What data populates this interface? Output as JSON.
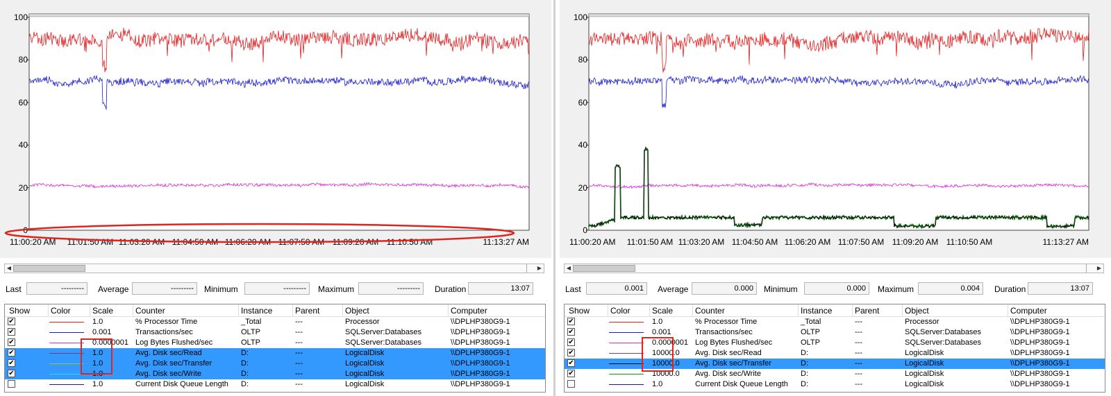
{
  "colors": {
    "red": "#e31c1c",
    "blue": "#1a1acc",
    "magenta": "#d92bd9",
    "green": "#119911",
    "black": "#000000",
    "highlight": "#3399ff",
    "annotation": "#e0231c"
  },
  "y_ticks": [
    "100",
    "80",
    "60",
    "40",
    "20",
    "0"
  ],
  "left": {
    "x_ticks": [
      "11:00:20 AM",
      "11:01:50 AM",
      "11:03:20 AM",
      "11:04:50 AM",
      "11:06:20 AM",
      "11:07:50 AM",
      "11:09:20 AM",
      "11:10:50 AM",
      "11:13:27 AM"
    ],
    "stats": {
      "last_label": "Last",
      "last": "---------",
      "average_label": "Average",
      "average": "---------",
      "minimum_label": "Minimum",
      "minimum": "---------",
      "maximum_label": "Maximum",
      "maximum": "---------",
      "duration_label": "Duration",
      "duration": "13:07"
    },
    "headers": [
      "Show",
      "Color",
      "Scale",
      "Counter",
      "Instance",
      "Parent",
      "Object",
      "Computer"
    ],
    "rows": [
      {
        "scale": "1.0",
        "counter": "% Processor Time",
        "instance": "_Total",
        "parent": "---",
        "object": "Processor",
        "computer": "\\\\DPLHP380G9-1",
        "color": "#e31c1c",
        "checked": true,
        "selected": false
      },
      {
        "scale": "0.001",
        "counter": "Transactions/sec",
        "instance": "OLTP",
        "parent": "---",
        "object": "SQLServer:Databases",
        "computer": "\\\\DPLHP380G9-1",
        "color": "#1a1acc",
        "checked": true,
        "selected": false
      },
      {
        "scale": "0.0000001",
        "counter": "Log Bytes Flushed/sec",
        "instance": "OLTP",
        "parent": "---",
        "object": "SQLServer:Databases",
        "computer": "\\\\DPLHP380G9-1",
        "color": "#d92bd9",
        "checked": true,
        "selected": false
      },
      {
        "scale": "1.0",
        "counter": "Avg. Disk sec/Read",
        "instance": "D:",
        "parent": "---",
        "object": "LogicalDisk",
        "computer": "\\\\DPLHP380G9-1",
        "color": "#7a3a7a",
        "checked": true,
        "selected": true
      },
      {
        "scale": "1.0",
        "counter": "Avg. Disk sec/Transfer",
        "instance": "D:",
        "parent": "---",
        "object": "LogicalDisk",
        "computer": "\\\\DPLHP380G9-1",
        "color": "#a0c040",
        "checked": true,
        "selected": true
      },
      {
        "scale": "1.0",
        "counter": "Avg. Disk sec/Write",
        "instance": "D:",
        "parent": "---",
        "object": "LogicalDisk",
        "computer": "\\\\DPLHP380G9-1",
        "color": "#20e0e0",
        "checked": true,
        "selected": true
      },
      {
        "scale": "1.0",
        "counter": "Current Disk Queue Length",
        "instance": "D:",
        "parent": "---",
        "object": "LogicalDisk",
        "computer": "\\\\DPLHP380G9-1",
        "color": "#1a1a80",
        "checked": false,
        "selected": false
      }
    ]
  },
  "right": {
    "x_ticks": [
      "11:00:20 AM",
      "11:01:50 AM",
      "11:03:20 AM",
      "11:04:50 AM",
      "11:06:20 AM",
      "11:07:50 AM",
      "11:09:20 AM",
      "11:10:50 AM",
      "11:13:27 AM"
    ],
    "stats": {
      "last_label": "Last",
      "last": "0.001",
      "average_label": "Average",
      "average": "0.000",
      "minimum_label": "Minimum",
      "minimum": "0.000",
      "maximum_label": "Maximum",
      "maximum": "0.004",
      "duration_label": "Duration",
      "duration": "13:07"
    },
    "headers": [
      "Show",
      "Color",
      "Scale",
      "Counter",
      "Instance",
      "Parent",
      "Object",
      "Computer"
    ],
    "rows": [
      {
        "scale": "1.0",
        "counter": "% Processor Time",
        "instance": "_Total",
        "parent": "---",
        "object": "Processor",
        "computer": "\\\\DPLHP380G9-1",
        "color": "#e31c1c",
        "checked": true,
        "selected": false
      },
      {
        "scale": "0.001",
        "counter": "Transactions/sec",
        "instance": "OLTP",
        "parent": "---",
        "object": "SQLServer:Databases",
        "computer": "\\\\DPLHP380G9-1",
        "color": "#1a1acc",
        "checked": true,
        "selected": false
      },
      {
        "scale": "0.0000001",
        "counter": "Log Bytes Flushed/sec",
        "instance": "OLTP",
        "parent": "---",
        "object": "SQLServer:Databases",
        "computer": "\\\\DPLHP380G9-1",
        "color": "#d92bd9",
        "checked": true,
        "selected": false
      },
      {
        "scale": "10000.0",
        "counter": "Avg. Disk sec/Read",
        "instance": "D:",
        "parent": "---",
        "object": "LogicalDisk",
        "computer": "\\\\DPLHP380G9-1",
        "color": "#7a3a7a",
        "checked": true,
        "selected": false
      },
      {
        "scale": "10000.0",
        "counter": "Avg. Disk sec/Transfer",
        "instance": "D:",
        "parent": "---",
        "object": "LogicalDisk",
        "computer": "\\\\DPLHP380G9-1",
        "color": "#000000",
        "checked": true,
        "selected": true
      },
      {
        "scale": "10000.0",
        "counter": "Avg. Disk sec/Write",
        "instance": "D:",
        "parent": "---",
        "object": "LogicalDisk",
        "computer": "\\\\DPLHP380G9-1",
        "color": "#119911",
        "checked": true,
        "selected": false
      },
      {
        "scale": "1.0",
        "counter": "Current Disk Queue Length",
        "instance": "D:",
        "parent": "---",
        "object": "LogicalDisk",
        "computer": "\\\\DPLHP380G9-1",
        "color": "#1a1a80",
        "checked": false,
        "selected": false
      }
    ]
  },
  "chart_data": [
    {
      "type": "line",
      "ylim": [
        0,
        100
      ],
      "x_start": "11:00:20 AM",
      "x_end": "11:13:27 AM",
      "series": [
        {
          "name": "% Processor Time",
          "color": "#e31c1c",
          "mean": 90,
          "noise": 4
        },
        {
          "name": "Transactions/sec",
          "color": "#1a1acc",
          "mean": 70,
          "noise": 2
        },
        {
          "name": "Log Bytes Flushed/sec",
          "color": "#d92bd9",
          "mean": 21,
          "noise": 0.8
        }
      ]
    },
    {
      "type": "line",
      "ylim": [
        0,
        100
      ],
      "x_start": "11:00:20 AM",
      "x_end": "11:13:27 AM",
      "series": [
        {
          "name": "% Processor Time",
          "color": "#e31c1c",
          "mean": 90,
          "noise": 4
        },
        {
          "name": "Transactions/sec",
          "color": "#1a1acc",
          "mean": 70,
          "noise": 2
        },
        {
          "name": "Log Bytes Flushed/sec",
          "color": "#d92bd9",
          "mean": 21,
          "noise": 0.8
        },
        {
          "name": "Avg. Disk sec/Transfer",
          "color": "#000000",
          "mean": 5,
          "noise": 1
        }
      ]
    }
  ]
}
